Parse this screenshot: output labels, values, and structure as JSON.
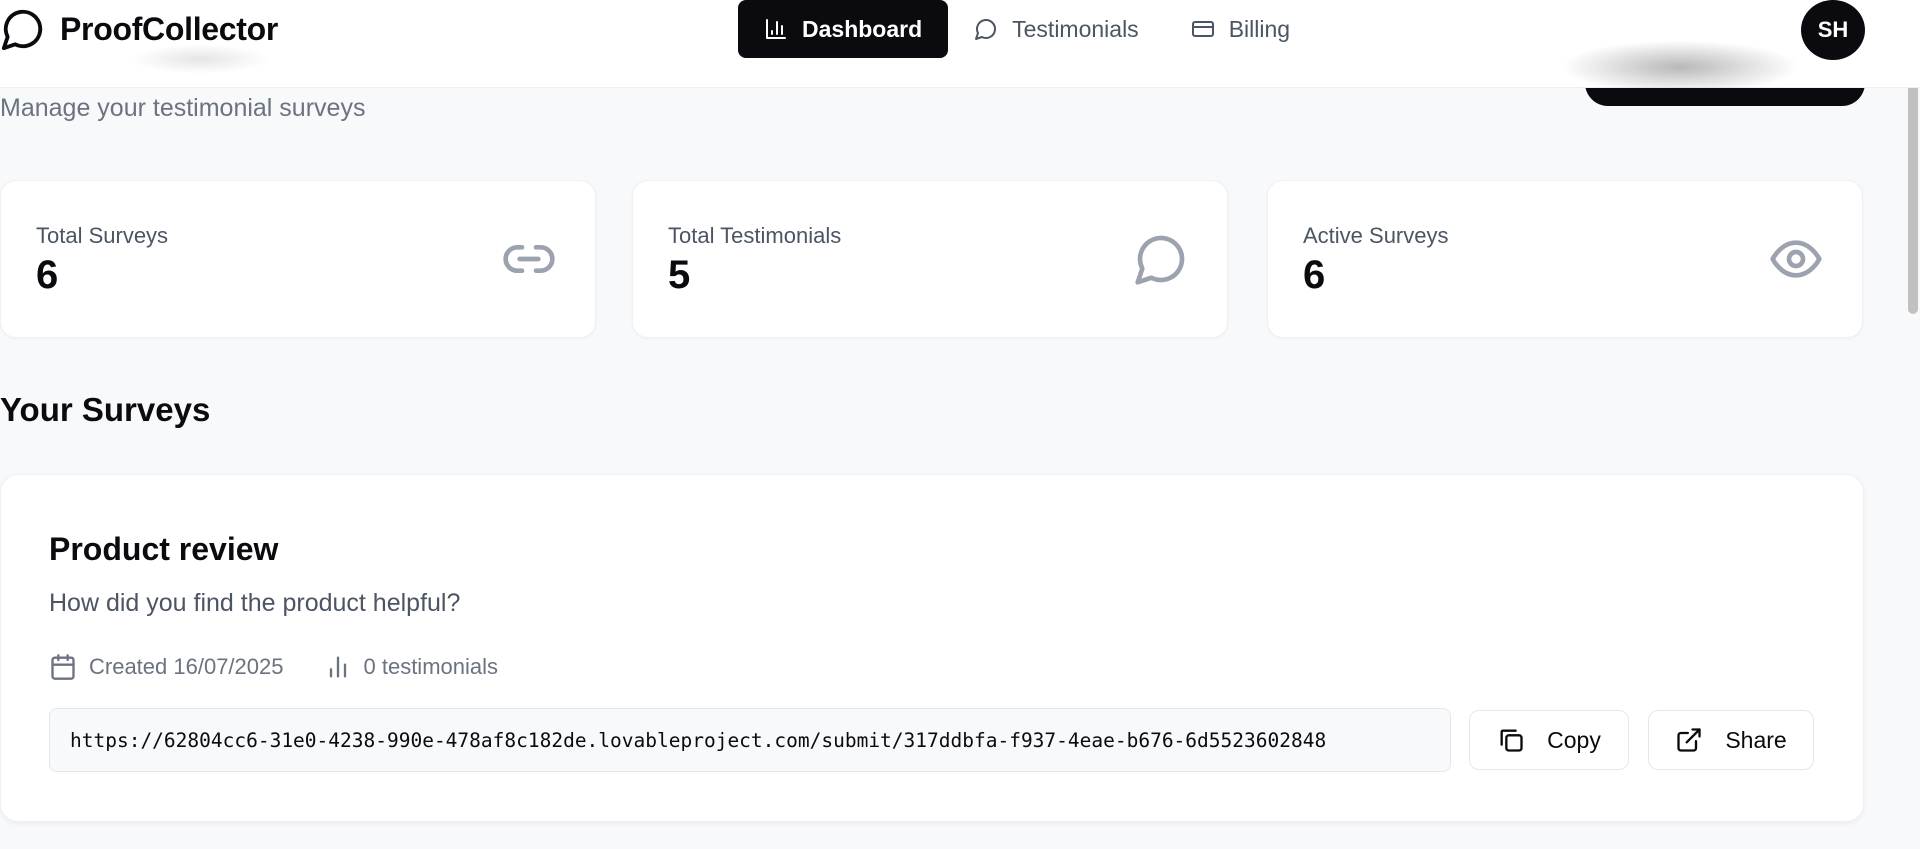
{
  "app": {
    "name": "ProofCollector"
  },
  "nav": {
    "dashboard": "Dashboard",
    "testimonials": "Testimonials",
    "billing": "Billing"
  },
  "user": {
    "initials": "SH"
  },
  "page": {
    "subtitle": "Manage your testimonial surveys"
  },
  "stats": [
    {
      "label": "Total Surveys",
      "value": "6",
      "icon": "link-icon"
    },
    {
      "label": "Total Testimonials",
      "value": "5",
      "icon": "message-icon"
    },
    {
      "label": "Active Surveys",
      "value": "6",
      "icon": "eye-icon"
    }
  ],
  "surveys_section": {
    "title": "Your Surveys"
  },
  "surveys": [
    {
      "title": "Product review",
      "description": "How did you find the product helpful?",
      "created": "Created 16/07/2025",
      "testimonials": "0 testimonials",
      "url": "https://62804cc6-31e0-4238-990e-478af8c182de.lovableproject.com/submit/317ddbfa-f937-4eae-b676-6d5523602848",
      "copy_label": "Copy",
      "share_label": "Share"
    }
  ],
  "colors": {
    "primary": "#0b0b0f",
    "muted": "#6b7280",
    "background": "#f8f9fb",
    "icon": "#9ca3af"
  }
}
